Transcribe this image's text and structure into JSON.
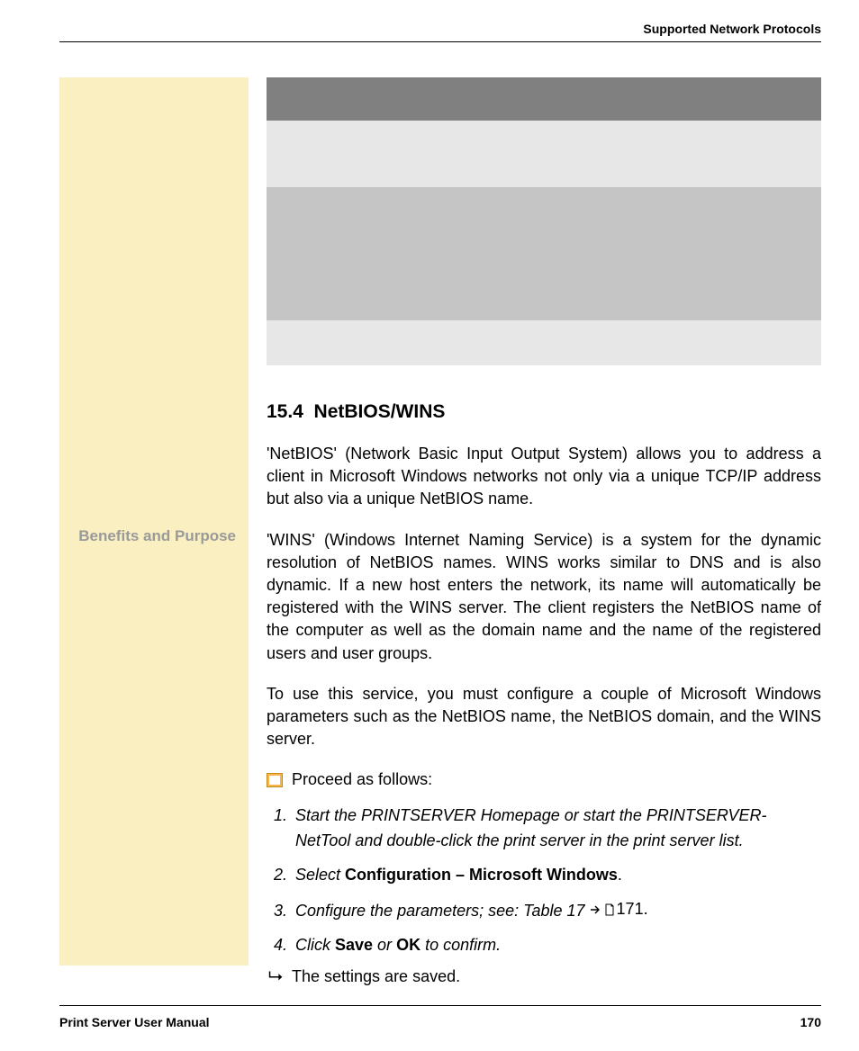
{
  "header": {
    "title": "Supported Network Protocols"
  },
  "margin_label": "Benefits and Purpose",
  "section": {
    "number": "15.4",
    "title": "NetBIOS/WINS"
  },
  "paragraphs": {
    "p1": "'NetBIOS' (Network Basic Input Output System) allows you to address a client in Microsoft Windows networks not only via a unique TCP/IP address but also via a unique NetBIOS name.",
    "p2": "'WINS' (Windows Internet Naming Service) is a system for the dynamic resolution of NetBIOS names. WINS works similar to DNS and is also dynamic. If a new host enters the network, its name will automatically be registered with the WINS server. The client registers the NetBIOS name of the computer as well as the domain name and the name of the registered users and user groups.",
    "p3": "To use this service, you must configure a couple of Microsoft Windows parameters such as the NetBIOS name, the NetBIOS domain, and the WINS server."
  },
  "proceed": "Proceed as follows:",
  "steps": {
    "s1": "Start the PRINTSERVER Homepage or start the PRINTSERVER-NetTool and double-click the print server in the print server list.",
    "s2_pre": "Select ",
    "s2_bold": "Configuration – Microsoft Windows",
    "s2_post": ".",
    "s3_pre": "Configure the parameters; see: Table 17",
    "s3_ref": "171.",
    "s4_pre": "Click ",
    "s4_b1": "Save",
    "s4_mid": " or ",
    "s4_b2": "OK",
    "s4_post": " to confirm."
  },
  "result": "The settings are saved.",
  "footer": {
    "left": "Print Server User Manual",
    "right": "170"
  }
}
